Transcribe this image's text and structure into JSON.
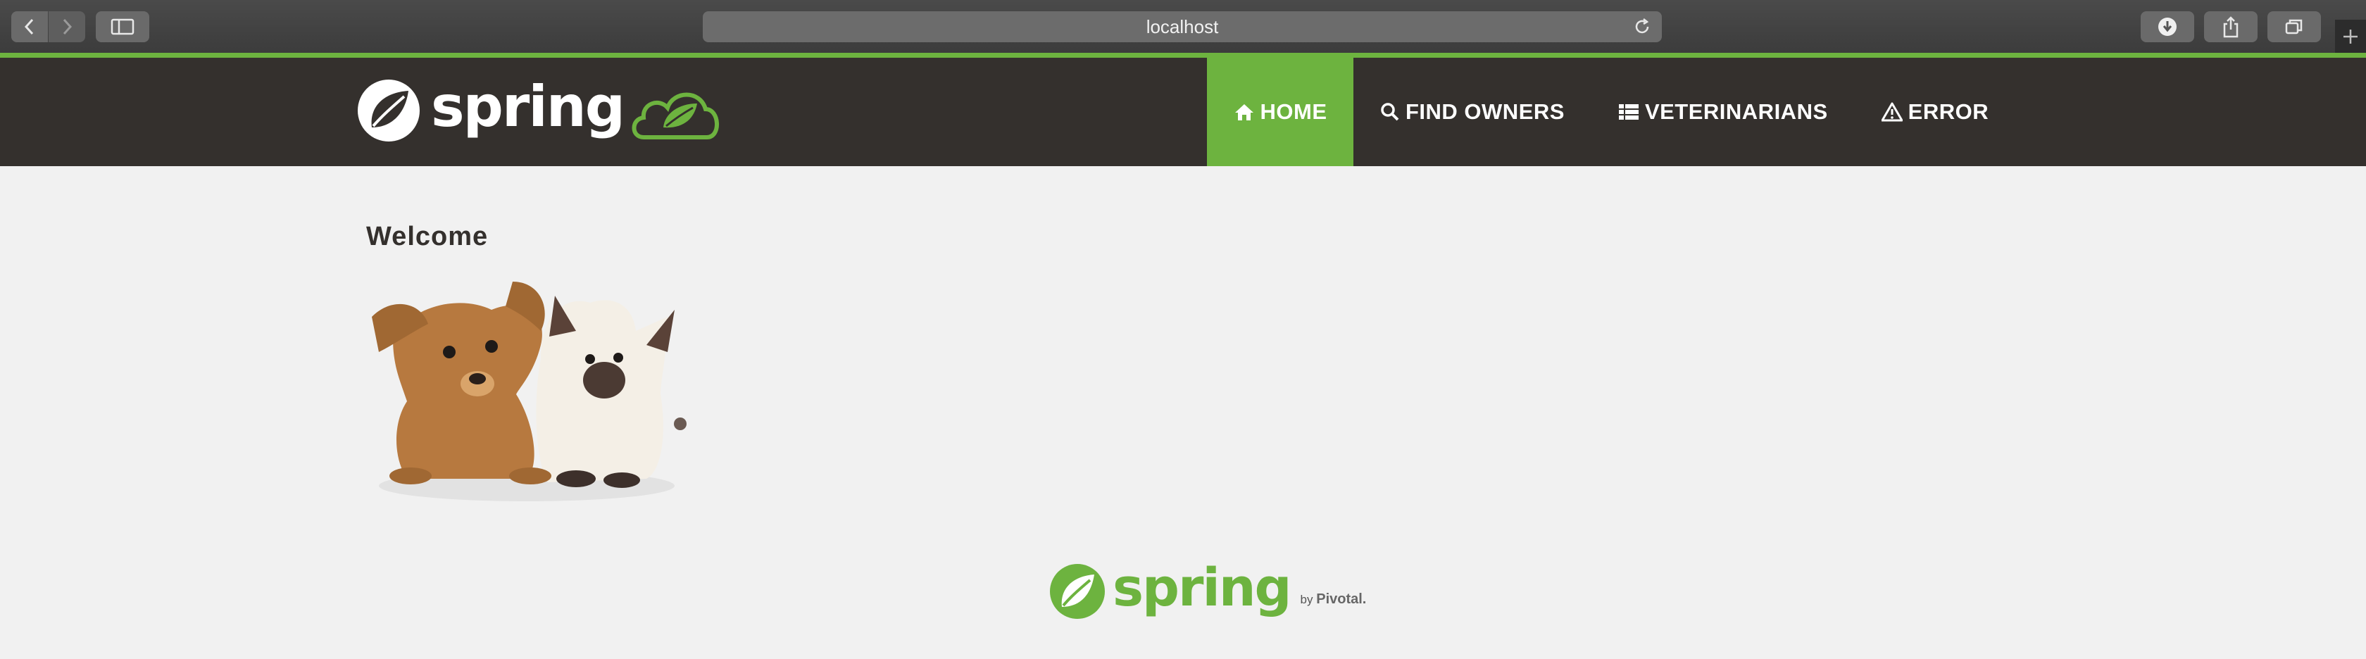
{
  "browser": {
    "address": "localhost",
    "accent_color": "#6db33f"
  },
  "navbar": {
    "brand": "spring",
    "items": [
      {
        "label": "HOME",
        "icon": "home-icon",
        "active": true
      },
      {
        "label": "FIND OWNERS",
        "icon": "search-icon",
        "active": false
      },
      {
        "label": "VETERINARIANS",
        "icon": "list-icon",
        "active": false
      },
      {
        "label": "ERROR",
        "icon": "warning-icon",
        "active": false
      }
    ],
    "background": "#34302d",
    "active_color": "#6db33f"
  },
  "main": {
    "title": "Welcome",
    "image": "puppy-and-kitten-photo"
  },
  "footer": {
    "brand": "spring",
    "by": "by",
    "company": "Pivotal."
  }
}
